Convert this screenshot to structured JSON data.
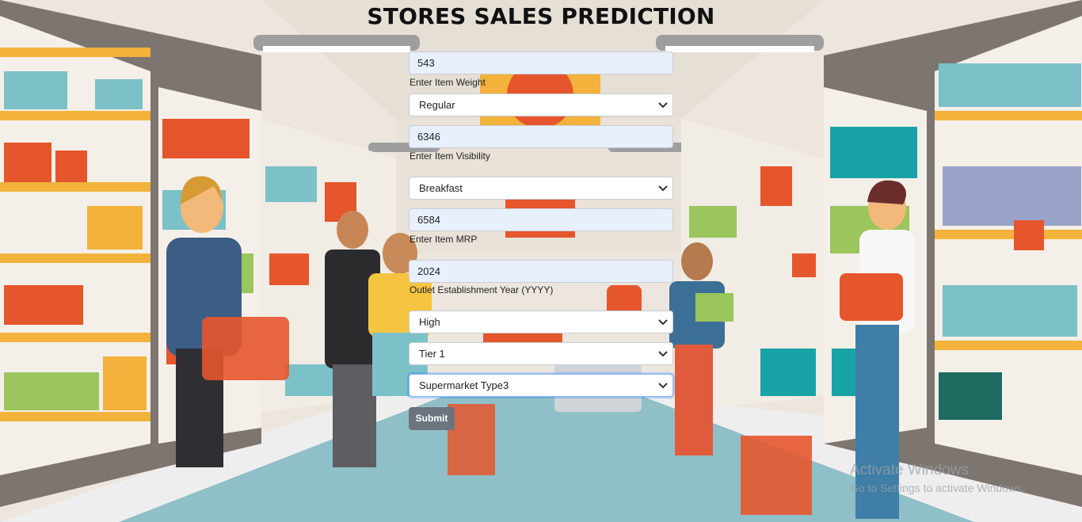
{
  "page": {
    "title": "STORES SALES PREDICTION"
  },
  "form": {
    "item_weight_value": "543",
    "item_weight_label": "Enter Item Weight",
    "fat_content_selected": "Regular",
    "item_visibility_value": "6346",
    "item_visibility_label": "Enter Item Visibility",
    "item_type_selected": "Breakfast",
    "item_mrp_value": "6584",
    "item_mrp_label": "Enter Item MRP",
    "establishment_year_value": "2024",
    "establishment_year_label": "Outlet Establishment Year (YYYY)",
    "outlet_size_selected": "High",
    "location_type_selected": "Tier 1",
    "outlet_type_selected": "Supermarket Type3",
    "submit_label": "Submit"
  },
  "watermark": {
    "line1": "Activate Windows",
    "line2": "Go to Settings to activate Windows."
  },
  "colors": {
    "submit_bg": "#6c757d",
    "input_bg": "#e8f0fe",
    "floor": "#8fbfc7"
  }
}
